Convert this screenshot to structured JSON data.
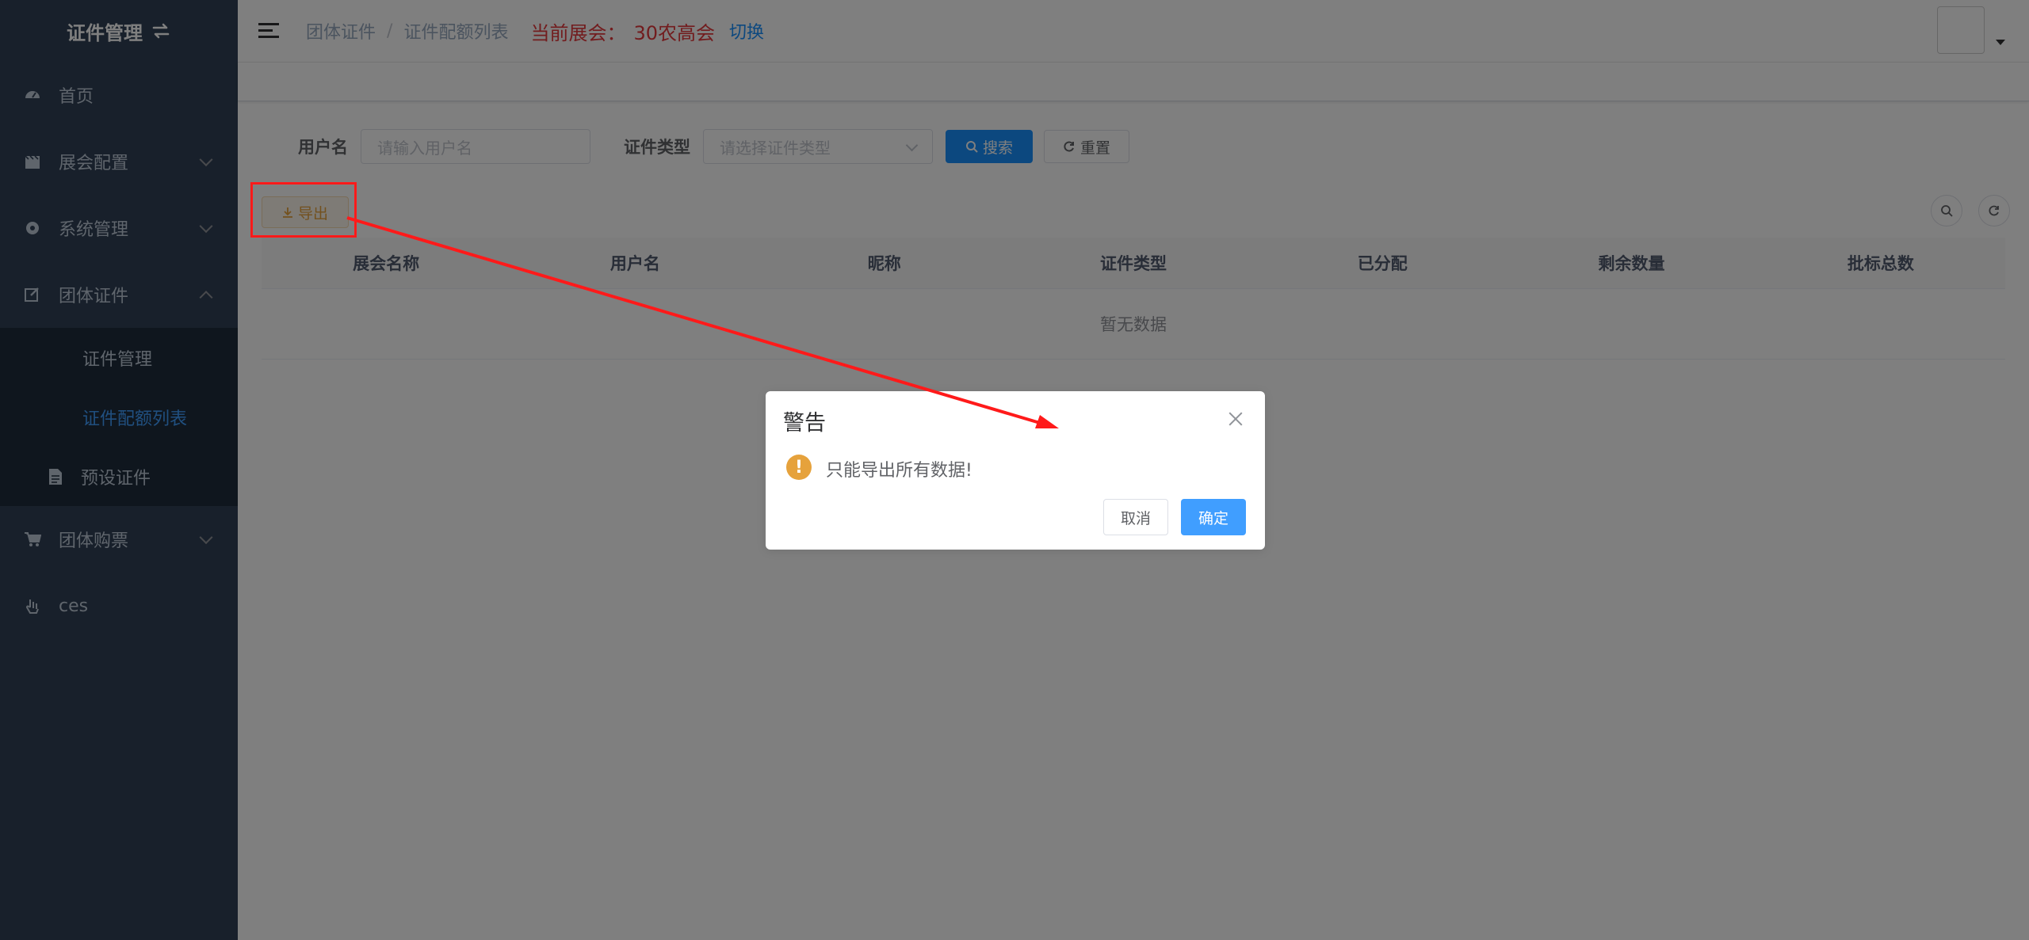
{
  "sidebar": {
    "logo": "证件管理",
    "items": [
      {
        "label": "首页",
        "icon": "dashboard-icon"
      },
      {
        "label": "展会配置",
        "icon": "clapperboard-icon"
      },
      {
        "label": "系统管理",
        "icon": "gear-icon"
      },
      {
        "label": "团体证件",
        "icon": "edit-icon"
      },
      {
        "label": "团体购票",
        "icon": "cart-icon"
      },
      {
        "label": "ces",
        "icon": "hand-icon"
      }
    ],
    "sub_items": [
      {
        "label": "证件管理"
      },
      {
        "label": "证件配额列表",
        "active": true
      },
      {
        "label": "预设证件",
        "icon": "document-icon"
      }
    ]
  },
  "header": {
    "breadcrumb": [
      "团体证件",
      "证件配额列表"
    ],
    "exhibit_label": "当前展会：",
    "exhibit_name": "30农高会",
    "switch_label": "切换"
  },
  "search": {
    "username_label": "用户名",
    "username_placeholder": "请输入用户名",
    "cert_type_label": "证件类型",
    "cert_type_placeholder": "请选择证件类型",
    "search_button": "搜索",
    "reset_button": "重置"
  },
  "toolbar": {
    "export_button": "导出"
  },
  "table": {
    "columns": [
      "展会名称",
      "用户名",
      "昵称",
      "证件类型",
      "已分配",
      "剩余数量",
      "批标总数"
    ],
    "empty_text": "暂无数据"
  },
  "dialog": {
    "title": "警告",
    "message": "只能导出所有数据!",
    "cancel_button": "取消",
    "confirm_button": "确定"
  },
  "colors": {
    "sidebar_bg": "#304156",
    "primary": "#1890ff",
    "warning": "#e6a23c",
    "highlight": "#e4393c",
    "annotation": "#ff1a1a"
  }
}
